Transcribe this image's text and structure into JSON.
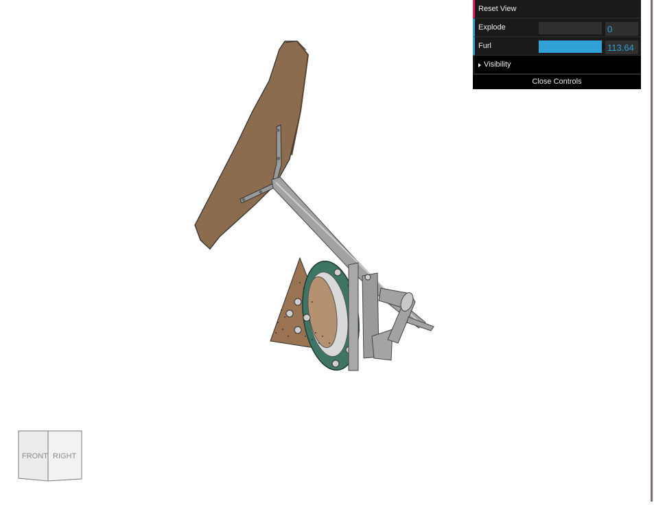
{
  "controls": {
    "reset_view_label": "Reset View",
    "explode": {
      "label": "Explode",
      "value": "0",
      "fraction": 0
    },
    "furl": {
      "label": "Furl",
      "value": "113.64",
      "fraction": 1
    },
    "visibility_label": "Visibility",
    "close_label": "Close Controls"
  },
  "view_cube": {
    "front_label": "FRONT",
    "right_label": "RIGHT"
  },
  "colors": {
    "panel_bg": "#1a1a1a",
    "function_accent": "#e61d5f",
    "number_accent": "#2fa1d6",
    "tail_vane": "#8c6c4e",
    "plywood": "#9a7452",
    "yaw_bearing": "#3e7564",
    "steel": "#9a9a9a"
  }
}
